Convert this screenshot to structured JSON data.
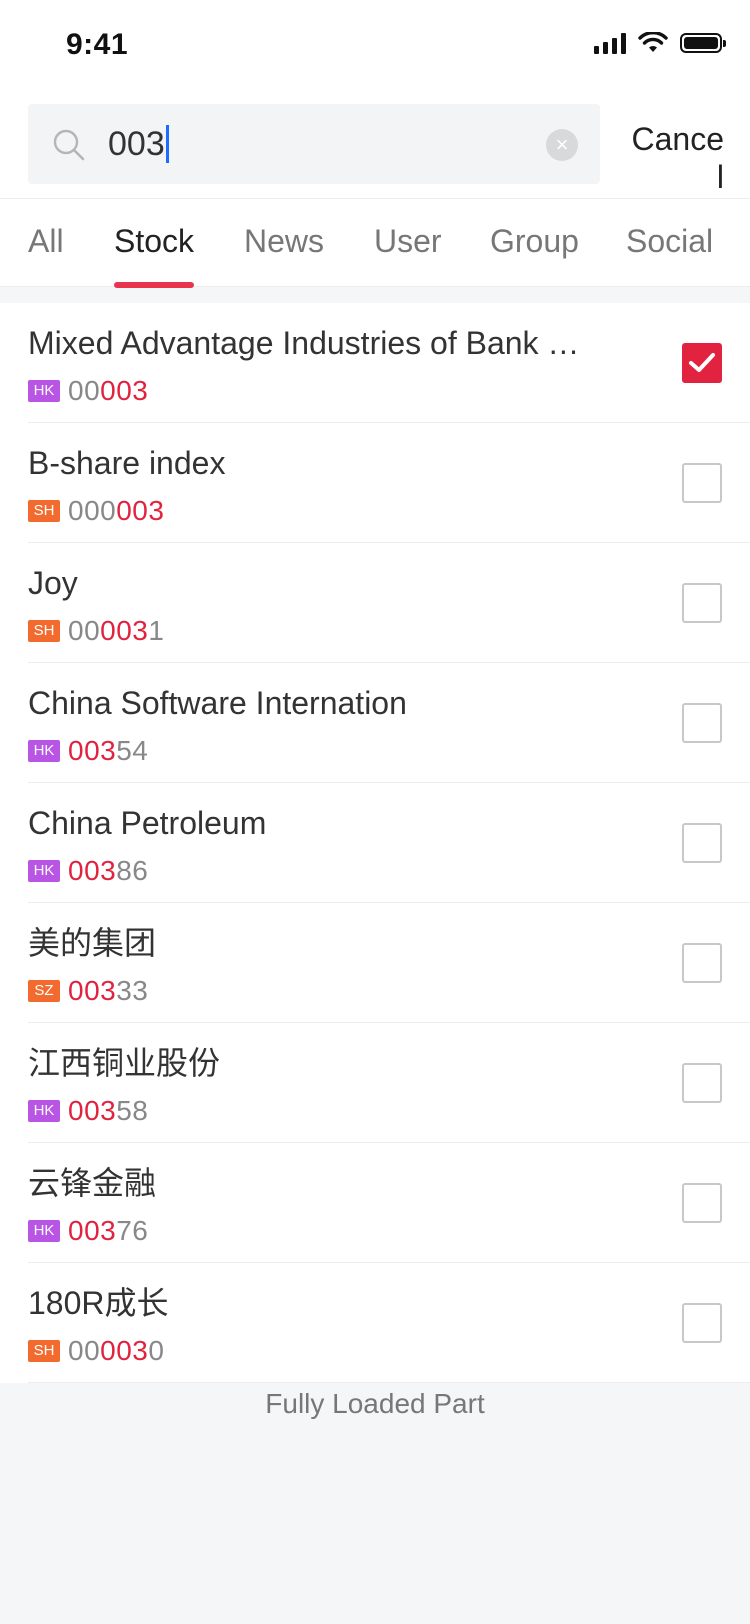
{
  "status_bar": {
    "time": "9:41"
  },
  "search": {
    "query": "003",
    "cancel_label": "Cancel"
  },
  "tabs": [
    {
      "label": "All",
      "active": false
    },
    {
      "label": "Stock",
      "active": true
    },
    {
      "label": "News",
      "active": false
    },
    {
      "label": "User",
      "active": false
    },
    {
      "label": "Group",
      "active": false
    },
    {
      "label": "Social",
      "active": false
    }
  ],
  "results": [
    {
      "name": "Mixed Advantage Industries of Bank Hong Kong",
      "market": "HK",
      "code_pre": "00",
      "code_match": "003",
      "code_post": "",
      "checked": true
    },
    {
      "name": "B-share index",
      "market": "SH",
      "code_pre": "000",
      "code_match": "003",
      "code_post": "",
      "checked": false
    },
    {
      "name": "Joy",
      "market": "SH",
      "code_pre": "00",
      "code_match": "003",
      "code_post": "1",
      "checked": false
    },
    {
      "name": "China Software Internation",
      "market": "HK",
      "code_pre": "",
      "code_match": "003",
      "code_post": "54",
      "checked": false
    },
    {
      "name": "China Petroleum",
      "market": "HK",
      "code_pre": "",
      "code_match": "003",
      "code_post": "86",
      "checked": false
    },
    {
      "name": "美的集团",
      "market": "SZ",
      "code_pre": "",
      "code_match": "003",
      "code_post": "33",
      "checked": false
    },
    {
      "name": "江西铜业股份",
      "market": "HK",
      "code_pre": "",
      "code_match": "003",
      "code_post": "58",
      "checked": false
    },
    {
      "name": "云锋金融",
      "market": "HK",
      "code_pre": "",
      "code_match": "003",
      "code_post": "76",
      "checked": false
    },
    {
      "name": "180R成长",
      "market": "SH",
      "code_pre": "00",
      "code_match": "003",
      "code_post": "0",
      "checked": false
    }
  ],
  "footer": {
    "text": "Fully Loaded Part"
  },
  "colors": {
    "accent": "#e2233f",
    "badge_hk": "#b855e5",
    "badge_cn": "#f26a2e",
    "caret": "#1f6bff"
  }
}
